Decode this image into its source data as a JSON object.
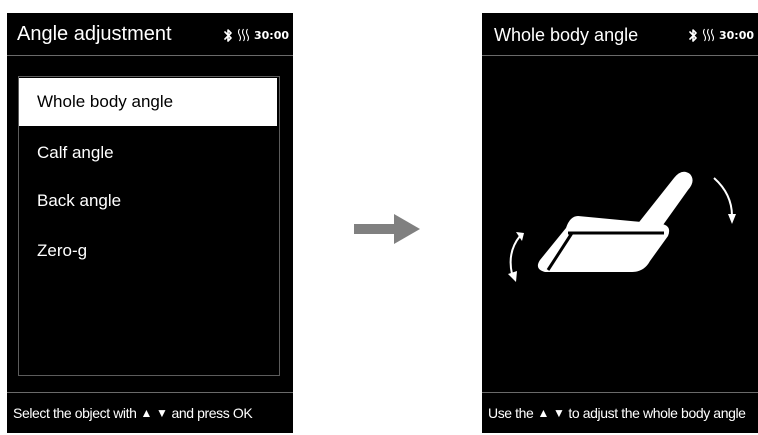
{
  "left_screen": {
    "title": "Angle adjustment",
    "timer": "30:00",
    "menu": [
      {
        "label": "Whole body angle",
        "selected": true
      },
      {
        "label": "Calf angle",
        "selected": false
      },
      {
        "label": "Back angle",
        "selected": false
      },
      {
        "label": "Zero-g",
        "selected": false
      }
    ],
    "footer": {
      "before": "Select the object with",
      "after": "and press OK"
    }
  },
  "right_screen": {
    "title": "Whole body angle",
    "timer": "30:00",
    "footer": {
      "before": "Use the",
      "after": "to adjust the whole body angle"
    }
  },
  "icons": {
    "status": [
      "bluetooth-icon",
      "heat-icon"
    ],
    "nav": [
      "triangle-up-icon",
      "triangle-down-icon"
    ],
    "transition": "right-arrow-icon",
    "illustration": [
      "massage-chair-icon",
      "rotate-clockwise-icon",
      "rotate-counterclockwise-icon"
    ]
  },
  "colors": {
    "screen": "#000000",
    "text": "#ffffff",
    "selected_bg": "#ffffff",
    "arrow": "#808080",
    "border": "#6a6a6a"
  }
}
